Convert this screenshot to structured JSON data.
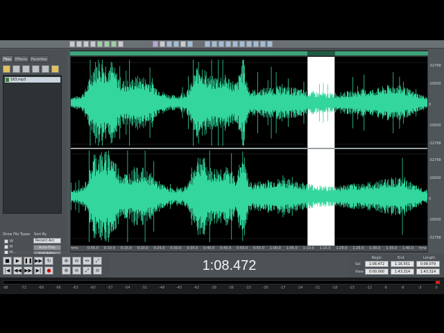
{
  "toolbar": {
    "icons": [
      "new-icon",
      "open-icon",
      "save-icon",
      "cut-icon",
      "copy-icon",
      "paste-icon",
      "undo-icon",
      "redo-icon",
      "mix-icon",
      "select-icon",
      "zoom-icon",
      "hand-icon",
      "pencil-icon",
      "scrub-icon"
    ]
  },
  "organizer": {
    "tabs": [
      "Files",
      "Effects",
      "Favorites"
    ],
    "active_tab": "Files",
    "files": [
      "183.mp3"
    ],
    "show_file_types_label": "Show File Types",
    "sort_by_label": "Sort By",
    "sort_selected": "Recent Acc",
    "file_types": [
      "W",
      "M",
      "M..."
    ],
    "buttons": [
      "Auto-Play",
      "Full Paths"
    ]
  },
  "waveform": {
    "y_labels_top": [
      "-32768",
      "-16000",
      "0",
      "-16000",
      "-32768"
    ],
    "y_labels_bottom": [
      "-32768",
      "-16000",
      "0",
      "-16000",
      "-32768"
    ],
    "time_labels": [
      "hms",
      "0:05.0",
      "0:10.0",
      "0:15.0",
      "0:20.0",
      "0:25.0",
      "0:30.0",
      "0:35.0",
      "0:40.0",
      "0:45.0",
      "0:50.0",
      "0:55.0",
      "1:00.0",
      "1:05.0",
      "1:10.0",
      "1:15.0",
      "1:20.0",
      "1:25.0",
      "1:30.0",
      "1:35.0",
      "1:40.0",
      "hms"
    ],
    "wave_color": "#33d69c",
    "selection_start_fraction": 0.664,
    "selection_end_fraction": 0.74
  },
  "transport": {
    "buttons_row1": [
      "■",
      "▶",
      "❚❚",
      "▶▶",
      "↻"
    ],
    "buttons_row2": [
      "|◀",
      "◀◀",
      "▶▶",
      "▶|",
      "●"
    ],
    "zoom_row1": [
      "⊕",
      "⊖",
      "↔",
      "⤢"
    ],
    "zoom_row2": [
      "⊕",
      "⊖",
      "⤢",
      "⊖"
    ],
    "time": "1:08.472"
  },
  "selection_panel": {
    "headers": [
      "Begin",
      "End",
      "Length"
    ],
    "rows": [
      {
        "label": "Sel",
        "begin": "1:08.472",
        "end": "1:16.551",
        "length": "0:08.079"
      },
      {
        "label": "View",
        "begin": "0:00.000",
        "end": "1:43.314",
        "length": "1:43.314"
      }
    ]
  },
  "meter": {
    "labels": [
      "dB",
      "-72",
      "-69",
      "-66",
      "-63",
      "-60",
      "-57",
      "-54",
      "-51",
      "-48",
      "-45",
      "-42",
      "-39",
      "-36",
      "-33",
      "-30",
      "-27",
      "-24",
      "-21",
      "-18",
      "-15",
      "-12",
      "-9",
      "-6",
      "-3",
      "0"
    ],
    "clip_color": "#e02020"
  }
}
